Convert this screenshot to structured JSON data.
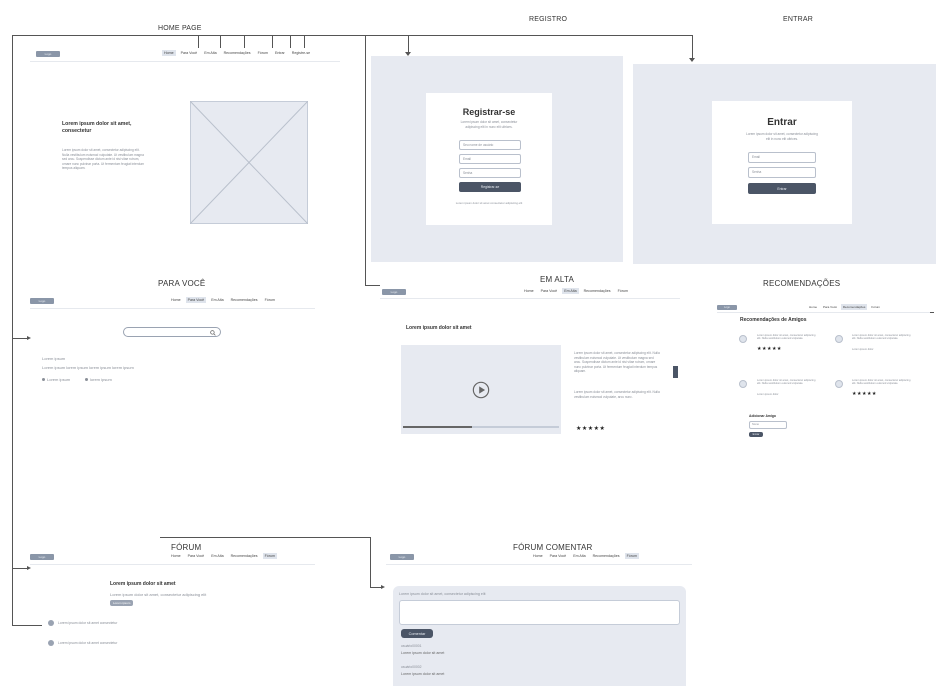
{
  "labels": {
    "home": "HOME PAGE",
    "registro": "REGISTRO",
    "entrar": "ENTRAR",
    "para_voce": "PARA VOCÊ",
    "em_alta": "EM ALTA",
    "recomendacoes": "RECOMENDAÇÕES",
    "forum": "FÓRUM",
    "forum_comentar": "FÓRUM COMENTAR"
  },
  "logo_text": "Logo",
  "nav_main": [
    "Home",
    "Para Você",
    "Em Alta",
    "Recomendações",
    "Fórum",
    "Entrar",
    "Registre-se"
  ],
  "nav_short": [
    "Home",
    "Para Você",
    "Em Alta",
    "Recomendações",
    "Fórum"
  ],
  "home": {
    "headline": "Lorem ipsum dolor sit amet, consectetur",
    "body": "Lorem ipsum dolor sit amet, consectetur adipiscing elit. Nulla vestibulum euismod vulputate. Ut vestibulum magna sed arcu. Suspendisse dictum ante id nisi vitae rutrum, ornare nunc pulvinar porta. Ut fermentum feugiat interdum tempus aliquam."
  },
  "registro": {
    "title": "Registrar-se",
    "subtitle": "Lorem ipsum dolor sit amet, consectetur adipiscing elit in nunc elit ultrices.",
    "name_placeholder": "Seu nome de usuário",
    "email_placeholder": "Email",
    "password_placeholder": "Senha",
    "button": "Registrar-se",
    "footer": "Lorem ipsum dolor sit amet consectetur adipiscing elit"
  },
  "entrar": {
    "title": "Entrar",
    "subtitle": "Lorem ipsum dolor sit amet, consectetur adipiscing elit in nunc elit ultrices.",
    "email_placeholder": "Email",
    "password_placeholder": "Senha",
    "button": "Entrar"
  },
  "para_voce": {
    "line1": "Lorem ipsum",
    "line2": "Lorem ipsum lorem ipsum lorem ipsum lorem ipsum",
    "opt1": "Lorem ipsum",
    "opt2": "lorem ipsum"
  },
  "em_alta": {
    "title": "Lorem ipsum dolor sit amet",
    "body1": "Lorem ipsum dolor sit amet, consectetur adipiscing elit. Nulla vestibulum euismod vulputate. Ut vestibulum magna sed arcu. Suspendisse dictum ante id nisi vitae rutrum, ornare nunc pulvinar porta. Ut fermentum feugiat interdum tempus aliquam.",
    "body2": "Lorem ipsum dolor sit amet, consectetur adipiscing elit. Nulla vestibulum euismod vulputate, arcu nunc.",
    "stars": "★★★★★"
  },
  "recomendacoes": {
    "heading": "Recomendações de Amigos",
    "item_text": "Lorem ipsum dolor sit amet, consectetur adipiscing elit. Nulla vestibulum euismod vulputate.",
    "item_caption": "Lorem ipsum dolor",
    "stars": "★★★★★",
    "add_friend": "Adicionar Amigo",
    "input_placeholder": "Nome",
    "button": "Enviar"
  },
  "forum": {
    "title": "Lorem ipsum dolor sit amet",
    "subtitle": "Lorem ipsum dolor sit amet, consectetur adipiscing elit",
    "badge": "Lorem ipsum",
    "item1": "Lorem ipsum dolor sit amet consectetur",
    "item2": "Lorem ipsum dolor sit amet consectetur"
  },
  "forum_comentar": {
    "prompt": "Lorem ipsum dolor sit amet, consectetur adipiscing elit",
    "button": "Comentar",
    "c1_user": "usuário00001",
    "c1_text": "Lorem ipsum dolor sit amet",
    "c2_user": "usuário00002",
    "c2_text": "Lorem ipsum dolor sit amet"
  }
}
